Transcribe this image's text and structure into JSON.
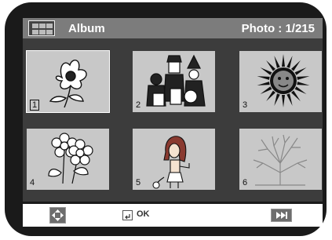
{
  "header": {
    "title": "Album",
    "counter": "Photo : 1/215",
    "view_icon": "grid-view-icon"
  },
  "thumbnails": [
    {
      "number": "1",
      "icon": "flower-icon",
      "selected": true
    },
    {
      "number": "2",
      "icon": "halloween-kids-icon",
      "selected": false
    },
    {
      "number": "3",
      "icon": "sun-icon",
      "selected": false
    },
    {
      "number": "4",
      "icon": "daisies-icon",
      "selected": false
    },
    {
      "number": "5",
      "icon": "girl-icon",
      "selected": false
    },
    {
      "number": "6",
      "icon": "bare-tree-icon",
      "selected": false
    }
  ],
  "footer": {
    "navigate_icon": "directional-pad-icon",
    "ok_label": "OK",
    "ok_icon": "enter-key-icon",
    "skip_icon": "skip-next-icon"
  }
}
